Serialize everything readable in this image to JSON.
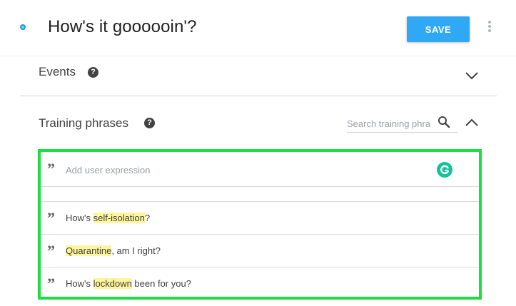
{
  "header": {
    "title": "How's it goooooin'?",
    "save_label": "SAVE"
  },
  "events": {
    "label": "Events",
    "help_glyph": "?"
  },
  "training": {
    "label": "Training phrases",
    "help_glyph": "?",
    "search_placeholder": "Search training phra",
    "add_placeholder": "Add user expression",
    "phrases": [
      {
        "before": "How's ",
        "highlight": "self-isolation",
        "after": "?"
      },
      {
        "before": "",
        "highlight": "Quarantine",
        "after": ", am I right?"
      },
      {
        "before": "How's ",
        "highlight": "lockdown",
        "after": " been for you?"
      }
    ]
  },
  "quote_glyph": "”",
  "colors": {
    "accent": "#2fa8f5",
    "highlight": "#fff59d",
    "selection_border": "#19e03d",
    "grammarly": "#15c39a"
  }
}
